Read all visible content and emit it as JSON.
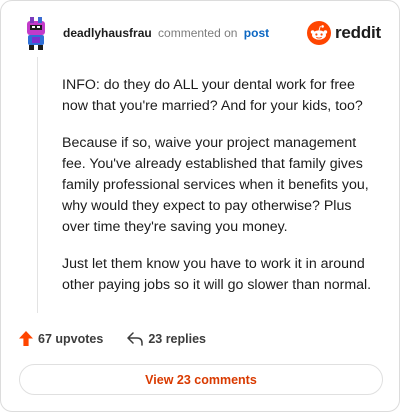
{
  "header": {
    "username": "deadlyhausfrau",
    "action_text": "commented on",
    "post_link": "post",
    "logo_text": "reddit"
  },
  "comment": {
    "paragraphs": [
      "INFO: do they do ALL your dental work for free now that you're married? And for your kids, too?",
      "Because if so, waive your project management fee. You've already established that family gives family professional services when it benefits you, why would they expect to pay otherwise? Plus over time they're saving you money.",
      "Just let them know you have to work it in around other paying jobs so it will go slower than normal."
    ]
  },
  "actions": {
    "upvotes": "67 upvotes",
    "replies": "23 replies"
  },
  "footer": {
    "view_comments": "View 23 comments"
  },
  "colors": {
    "accent": "#d93a00",
    "upvote": "#ff4500",
    "link": "#0a66c2"
  },
  "icons": [
    "avatar-icon",
    "reddit-logo-icon",
    "upvote-arrow-icon",
    "reply-arrow-icon"
  ]
}
